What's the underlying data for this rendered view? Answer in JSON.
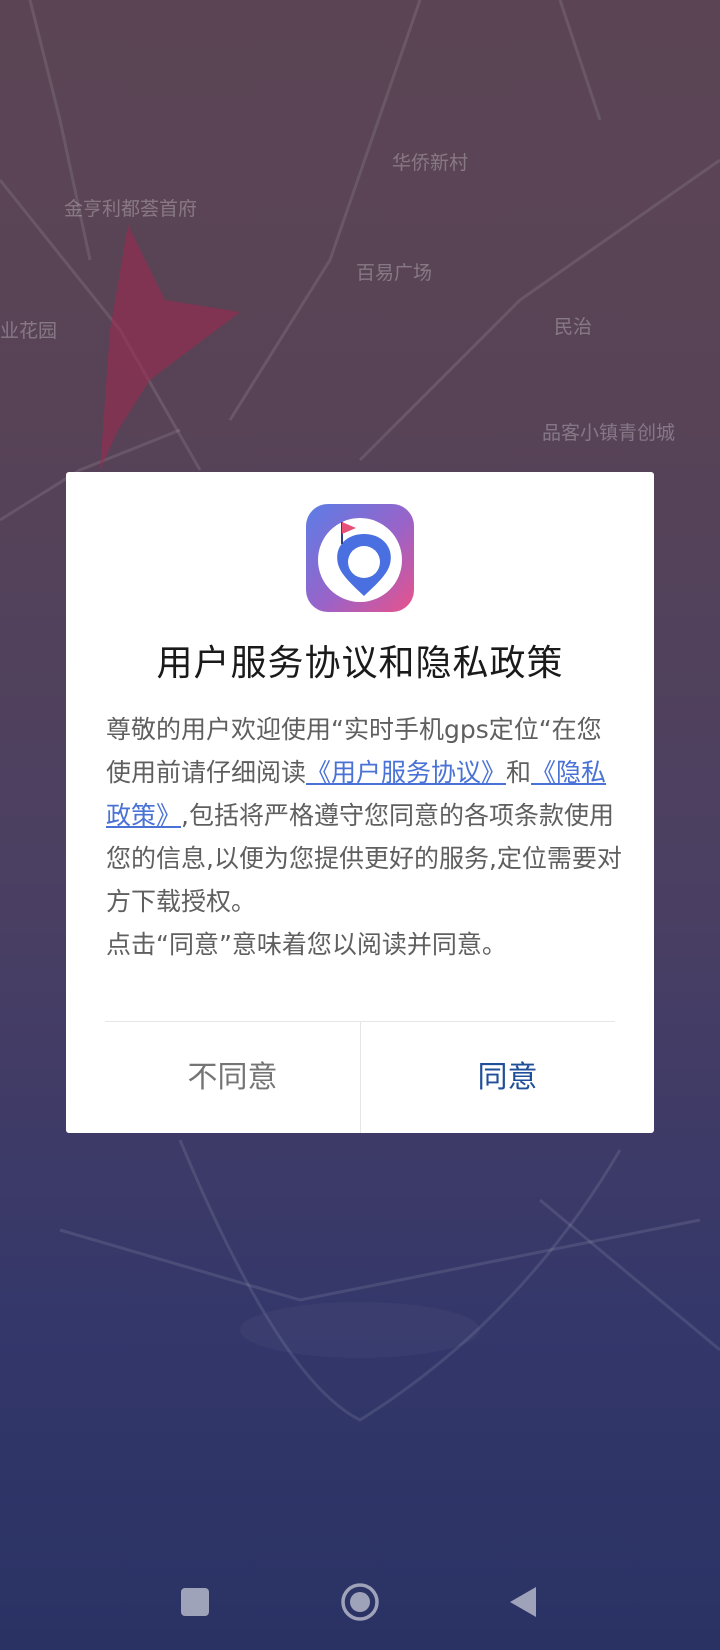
{
  "map": {
    "poi_labels": [
      "华侨新村",
      "金亨利都荟首府",
      "百易广场",
      "民治",
      "品客小镇青创城",
      "业花园"
    ]
  },
  "dialog": {
    "title": "用户服务协议和隐私政策",
    "body_intro": "尊敬的用户欢迎使用“实时手机gps定位“在您使用前请仔细阅读",
    "link_service": "《用户服务协议》",
    "conjunction": "和",
    "link_privacy": "《隐私政策》",
    "body_continue": ",包括将严格遵守您同意的各项条款使用您的信息,以便为您提供更好的服务,定位需要对方下载授权。",
    "body_note": "点击“同意”意味着您以阅读并同意。",
    "disagree_label": "不同意",
    "agree_label": "同意"
  },
  "colors": {
    "link": "#4a72d6",
    "agree": "#1f4f99",
    "disagree": "#757575"
  },
  "navbar": {
    "icons": [
      "recents-icon",
      "home-icon",
      "back-icon"
    ]
  }
}
